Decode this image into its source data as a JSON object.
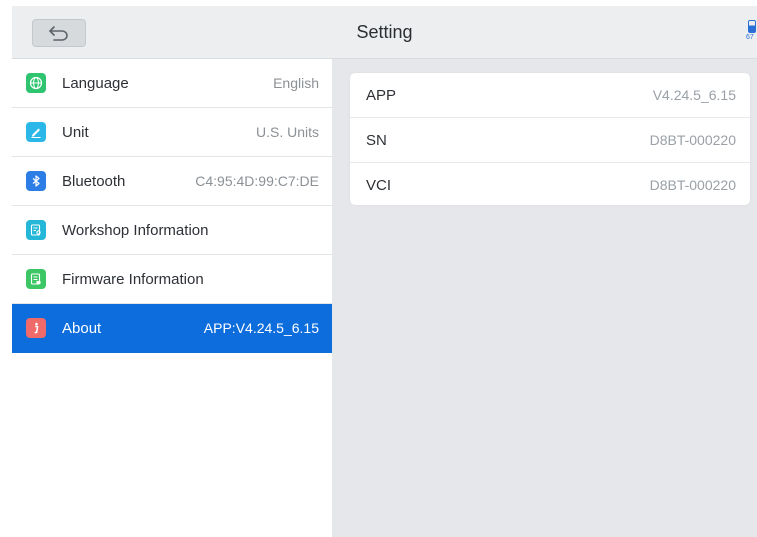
{
  "header": {
    "title": "Setting",
    "back_icon": "back-arrow-icon",
    "battery": {
      "level_percent": 67,
      "label": "67"
    }
  },
  "sidebar": {
    "items": [
      {
        "label": "Language",
        "value": "English",
        "icon": "globe-icon",
        "icon_color": "#2fc46f",
        "active": false
      },
      {
        "label": "Unit",
        "value": "U.S. Units",
        "icon": "pencil-icon",
        "icon_color": "#2bb8e8",
        "active": false
      },
      {
        "label": "Bluetooth",
        "value": "C4:95:4D:99:C7:DE",
        "icon": "bluetooth-icon",
        "icon_color": "#2d7de6",
        "active": false
      },
      {
        "label": "Workshop Information",
        "value": "",
        "icon": "document-search-icon",
        "icon_color": "#24b7d7",
        "active": false
      },
      {
        "label": "Firmware Information",
        "value": "",
        "icon": "firmware-document-icon",
        "icon_color": "#3cc764",
        "active": false
      },
      {
        "label": "About",
        "value": "APP:V4.24.5_6.15",
        "icon": "info-icon",
        "icon_color": "#f06a6a",
        "active": true
      }
    ]
  },
  "about": {
    "rows": [
      {
        "key": "APP",
        "value": "V4.24.5_6.15"
      },
      {
        "key": "SN",
        "value": "D8BT-000220"
      },
      {
        "key": "VCI",
        "value": "D8BT-000220"
      }
    ]
  },
  "colors": {
    "accent": "#0d6ddc",
    "background": "#e5e7ea"
  }
}
